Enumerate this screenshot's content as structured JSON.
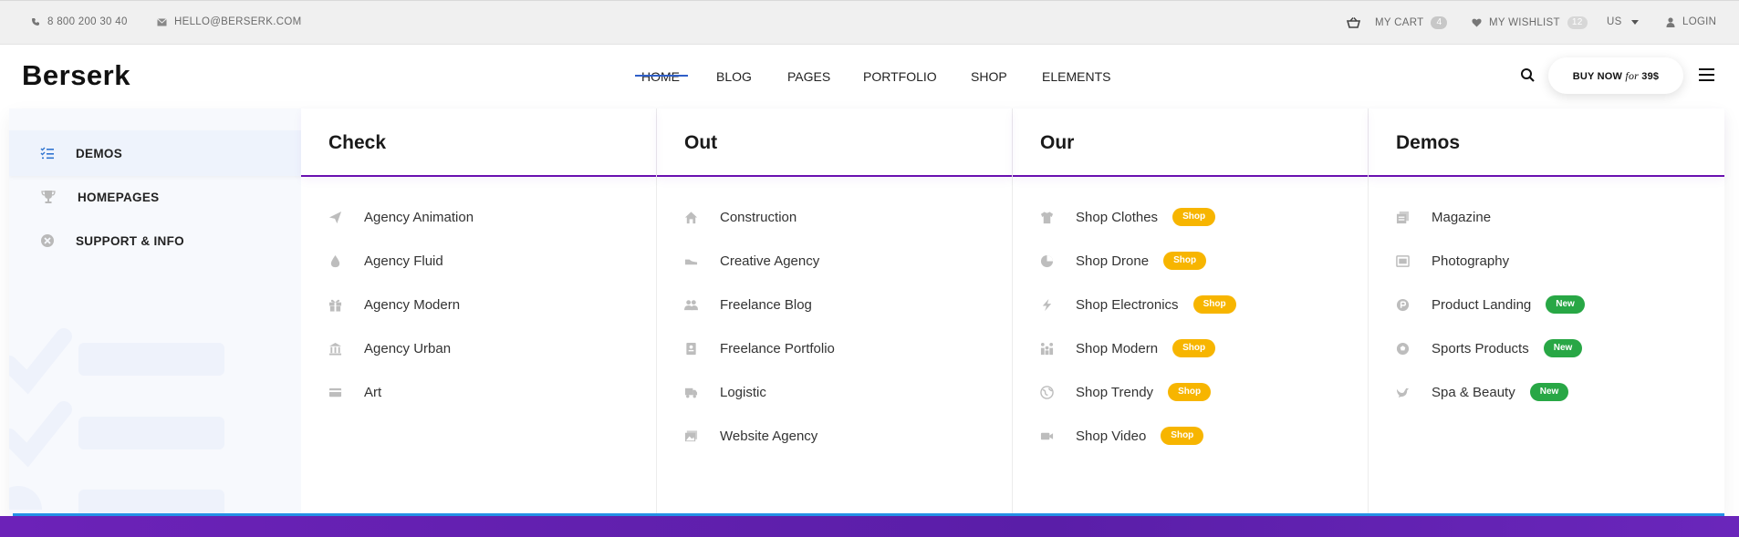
{
  "topbar": {
    "phone": "8 800 200 30 40",
    "email": "HELLO@BERSERK.COM",
    "cart_label": "MY CART",
    "cart_count": "4",
    "wishlist_label": "MY WISHLIST",
    "wishlist_count": "12",
    "currency": "US",
    "login": "LOGIN"
  },
  "header": {
    "logo": "Berserk",
    "nav": [
      "HOME",
      "BLOG",
      "PAGES",
      "PORTFOLIO",
      "SHOP",
      "ELEMENTS"
    ],
    "buy_prefix": "BUY NOW",
    "buy_for": "for",
    "buy_price": "39$"
  },
  "sidebar": {
    "items": [
      {
        "label": "DEMOS",
        "icon": "list-check-icon"
      },
      {
        "label": "HOMEPAGES",
        "icon": "trophy-icon"
      },
      {
        "label": "SUPPORT & INFO",
        "icon": "close-circle-icon"
      }
    ]
  },
  "columns": [
    {
      "title": "Check",
      "items": [
        {
          "label": "Agency Animation",
          "icon": "paper-plane-icon"
        },
        {
          "label": "Agency Fluid",
          "icon": "drop-icon"
        },
        {
          "label": "Agency Modern",
          "icon": "gift-icon"
        },
        {
          "label": "Agency Urban",
          "icon": "bank-icon"
        },
        {
          "label": "Art",
          "icon": "card-icon"
        }
      ]
    },
    {
      "title": "Out",
      "items": [
        {
          "label": "Construction",
          "icon": "home-icon"
        },
        {
          "label": "Creative Agency",
          "icon": "shoe-icon"
        },
        {
          "label": "Freelance Blog",
          "icon": "users-icon"
        },
        {
          "label": "Freelance Portfolio",
          "icon": "contact-card-icon"
        },
        {
          "label": "Logistic",
          "icon": "truck-icon"
        },
        {
          "label": "Website Agency",
          "icon": "images-icon"
        }
      ]
    },
    {
      "title": "Our",
      "items": [
        {
          "label": "Shop Clothes",
          "icon": "tshirt-icon",
          "badge": "Shop"
        },
        {
          "label": "Shop Drone",
          "icon": "pie-icon",
          "badge": "Shop"
        },
        {
          "label": "Shop Electronics",
          "icon": "bolt-icon",
          "badge": "Shop"
        },
        {
          "label": "Shop Modern",
          "icon": "group-icon",
          "badge": "Shop"
        },
        {
          "label": "Shop Trendy",
          "icon": "globe-icon",
          "badge": "Shop"
        },
        {
          "label": "Shop Video",
          "icon": "video-icon",
          "badge": "Shop"
        }
      ]
    },
    {
      "title": "Demos",
      "items": [
        {
          "label": "Magazine",
          "icon": "copy-icon"
        },
        {
          "label": "Photography",
          "icon": "photo-icon"
        },
        {
          "label": "Product Landing",
          "icon": "product-icon",
          "badge": "New"
        },
        {
          "label": "Sports Products",
          "icon": "ball-icon",
          "badge": "New"
        },
        {
          "label": "Spa & Beauty",
          "icon": "bird-icon",
          "badge": "New"
        }
      ]
    }
  ],
  "colors": {
    "accent_underline": "#6a11b0",
    "badge_shop": "#f7b500",
    "badge_new": "#28a745",
    "bottom_line": "#2591e6"
  }
}
